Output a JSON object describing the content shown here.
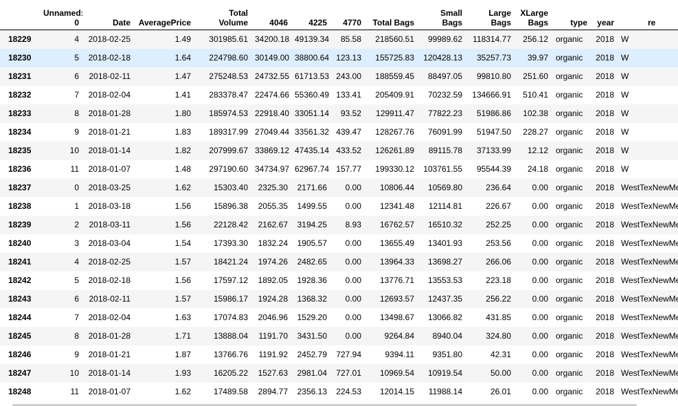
{
  "columns": [
    {
      "key": "Unnamed: 0",
      "lines": [
        "Unnamed:",
        "0"
      ]
    },
    {
      "key": "Date",
      "lines": [
        "Date"
      ]
    },
    {
      "key": "AveragePrice",
      "lines": [
        "AveragePrice"
      ]
    },
    {
      "key": "Total Volume",
      "lines": [
        "Total",
        "Volume"
      ]
    },
    {
      "key": "4046",
      "lines": [
        "4046"
      ]
    },
    {
      "key": "4225",
      "lines": [
        "4225"
      ]
    },
    {
      "key": "4770",
      "lines": [
        "4770"
      ]
    },
    {
      "key": "Total Bags",
      "lines": [
        "Total Bags"
      ]
    },
    {
      "key": "Small Bags",
      "lines": [
        "Small",
        "Bags"
      ]
    },
    {
      "key": "Large Bags",
      "lines": [
        "Large",
        "Bags"
      ]
    },
    {
      "key": "XLarge Bags",
      "lines": [
        "XLarge",
        "Bags"
      ]
    },
    {
      "key": "type",
      "lines": [
        "type"
      ]
    },
    {
      "key": "year",
      "lines": [
        "year"
      ]
    },
    {
      "key": "region",
      "lines": [
        "re"
      ]
    }
  ],
  "rows": [
    {
      "index": "18229",
      "cells": [
        "4",
        "2018-02-25",
        "1.49",
        "301985.61",
        "34200.18",
        "49139.34",
        "85.58",
        "218560.51",
        "99989.62",
        "118314.77",
        "256.12",
        "organic",
        "2018",
        "W"
      ]
    },
    {
      "index": "18230",
      "cells": [
        "5",
        "2018-02-18",
        "1.64",
        "224798.60",
        "30149.00",
        "38800.64",
        "123.13",
        "155725.83",
        "120428.13",
        "35257.73",
        "39.97",
        "organic",
        "2018",
        "W"
      ]
    },
    {
      "index": "18231",
      "cells": [
        "6",
        "2018-02-11",
        "1.47",
        "275248.53",
        "24732.55",
        "61713.53",
        "243.00",
        "188559.45",
        "88497.05",
        "99810.80",
        "251.60",
        "organic",
        "2018",
        "W"
      ]
    },
    {
      "index": "18232",
      "cells": [
        "7",
        "2018-02-04",
        "1.41",
        "283378.47",
        "22474.66",
        "55360.49",
        "133.41",
        "205409.91",
        "70232.59",
        "134666.91",
        "510.41",
        "organic",
        "2018",
        "W"
      ]
    },
    {
      "index": "18233",
      "cells": [
        "8",
        "2018-01-28",
        "1.80",
        "185974.53",
        "22918.40",
        "33051.14",
        "93.52",
        "129911.47",
        "77822.23",
        "51986.86",
        "102.38",
        "organic",
        "2018",
        "W"
      ]
    },
    {
      "index": "18234",
      "cells": [
        "9",
        "2018-01-21",
        "1.83",
        "189317.99",
        "27049.44",
        "33561.32",
        "439.47",
        "128267.76",
        "76091.99",
        "51947.50",
        "228.27",
        "organic",
        "2018",
        "W"
      ]
    },
    {
      "index": "18235",
      "cells": [
        "10",
        "2018-01-14",
        "1.82",
        "207999.67",
        "33869.12",
        "47435.14",
        "433.52",
        "126261.89",
        "89115.78",
        "37133.99",
        "12.12",
        "organic",
        "2018",
        "W"
      ]
    },
    {
      "index": "18236",
      "cells": [
        "11",
        "2018-01-07",
        "1.48",
        "297190.60",
        "34734.97",
        "62967.74",
        "157.77",
        "199330.12",
        "103761.55",
        "95544.39",
        "24.18",
        "organic",
        "2018",
        "W"
      ]
    },
    {
      "index": "18237",
      "cells": [
        "0",
        "2018-03-25",
        "1.62",
        "15303.40",
        "2325.30",
        "2171.66",
        "0.00",
        "10806.44",
        "10569.80",
        "236.64",
        "0.00",
        "organic",
        "2018",
        "WestTexNewMe"
      ]
    },
    {
      "index": "18238",
      "cells": [
        "1",
        "2018-03-18",
        "1.56",
        "15896.38",
        "2055.35",
        "1499.55",
        "0.00",
        "12341.48",
        "12114.81",
        "226.67",
        "0.00",
        "organic",
        "2018",
        "WestTexNewMe"
      ]
    },
    {
      "index": "18239",
      "cells": [
        "2",
        "2018-03-11",
        "1.56",
        "22128.42",
        "2162.67",
        "3194.25",
        "8.93",
        "16762.57",
        "16510.32",
        "252.25",
        "0.00",
        "organic",
        "2018",
        "WestTexNewMe"
      ]
    },
    {
      "index": "18240",
      "cells": [
        "3",
        "2018-03-04",
        "1.54",
        "17393.30",
        "1832.24",
        "1905.57",
        "0.00",
        "13655.49",
        "13401.93",
        "253.56",
        "0.00",
        "organic",
        "2018",
        "WestTexNewMe"
      ]
    },
    {
      "index": "18241",
      "cells": [
        "4",
        "2018-02-25",
        "1.57",
        "18421.24",
        "1974.26",
        "2482.65",
        "0.00",
        "13964.33",
        "13698.27",
        "266.06",
        "0.00",
        "organic",
        "2018",
        "WestTexNewMe"
      ]
    },
    {
      "index": "18242",
      "cells": [
        "5",
        "2018-02-18",
        "1.56",
        "17597.12",
        "1892.05",
        "1928.36",
        "0.00",
        "13776.71",
        "13553.53",
        "223.18",
        "0.00",
        "organic",
        "2018",
        "WestTexNewMe"
      ]
    },
    {
      "index": "18243",
      "cells": [
        "6",
        "2018-02-11",
        "1.57",
        "15986.17",
        "1924.28",
        "1368.32",
        "0.00",
        "12693.57",
        "12437.35",
        "256.22",
        "0.00",
        "organic",
        "2018",
        "WestTexNewMe"
      ]
    },
    {
      "index": "18244",
      "cells": [
        "7",
        "2018-02-04",
        "1.63",
        "17074.83",
        "2046.96",
        "1529.20",
        "0.00",
        "13498.67",
        "13066.82",
        "431.85",
        "0.00",
        "organic",
        "2018",
        "WestTexNewMe"
      ]
    },
    {
      "index": "18245",
      "cells": [
        "8",
        "2018-01-28",
        "1.71",
        "13888.04",
        "1191.70",
        "3431.50",
        "0.00",
        "9264.84",
        "8940.04",
        "324.80",
        "0.00",
        "organic",
        "2018",
        "WestTexNewMe"
      ]
    },
    {
      "index": "18246",
      "cells": [
        "9",
        "2018-01-21",
        "1.87",
        "13766.76",
        "1191.92",
        "2452.79",
        "727.94",
        "9394.11",
        "9351.80",
        "42.31",
        "0.00",
        "organic",
        "2018",
        "WestTexNewMe"
      ]
    },
    {
      "index": "18247",
      "cells": [
        "10",
        "2018-01-14",
        "1.93",
        "16205.22",
        "1527.63",
        "2981.04",
        "727.01",
        "10969.54",
        "10919.54",
        "50.00",
        "0.00",
        "organic",
        "2018",
        "WestTexNewMe"
      ]
    },
    {
      "index": "18248",
      "cells": [
        "11",
        "2018-01-07",
        "1.62",
        "17489.58",
        "2894.77",
        "2356.13",
        "224.53",
        "12014.15",
        "11988.14",
        "26.01",
        "0.00",
        "organic",
        "2018",
        "WestTexNewMe"
      ]
    }
  ],
  "hovered_row_index": "18230"
}
